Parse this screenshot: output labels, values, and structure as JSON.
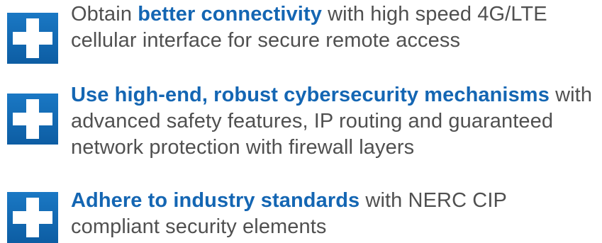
{
  "features": [
    {
      "highlight": "better connectivity",
      "prefix": "Obtain ",
      "suffix": " with high speed 4G/LTE cellular interface for secure remote access"
    },
    {
      "highlight": "Use high-end, robust cybersecurity mechanisms",
      "prefix": "",
      "suffix": " with advanced safety features, IP routing and guaranteed network protection with firewall layers"
    },
    {
      "highlight": "Adhere to industry standards",
      "prefix": "",
      "suffix": " with NERC CIP compliant security elements"
    }
  ],
  "colors": {
    "icon": "#1466b3",
    "highlight": "#1466b3",
    "text": "#505050"
  },
  "icon_name": "plus-icon"
}
